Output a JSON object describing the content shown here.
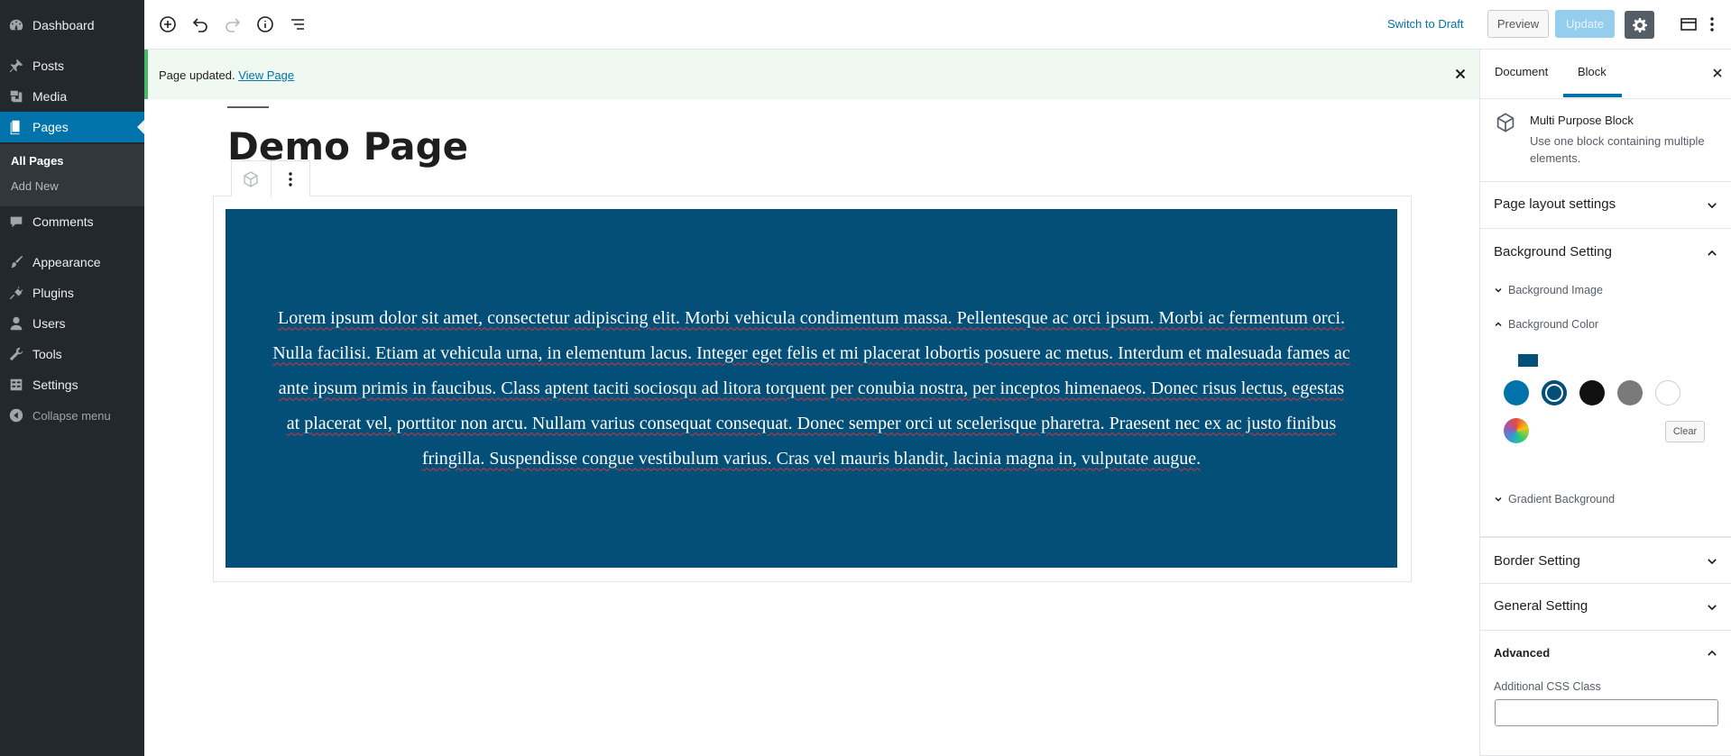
{
  "admin_menu": {
    "items": [
      {
        "label": "Dashboard",
        "icon": "dashboard-icon"
      },
      {
        "label": "Posts",
        "icon": "pin-icon"
      },
      {
        "label": "Media",
        "icon": "media-icon"
      },
      {
        "label": "Pages",
        "icon": "pages-icon",
        "current": true
      },
      {
        "label": "Comments",
        "icon": "comment-icon"
      },
      {
        "label": "Appearance",
        "icon": "brush-icon"
      },
      {
        "label": "Plugins",
        "icon": "plug-icon"
      },
      {
        "label": "Users",
        "icon": "user-icon"
      },
      {
        "label": "Tools",
        "icon": "wrench-icon"
      },
      {
        "label": "Settings",
        "icon": "settings-icon"
      },
      {
        "label": "Collapse menu",
        "icon": "collapse-icon"
      }
    ],
    "submenu": [
      "All Pages",
      "Add New"
    ]
  },
  "toolbar": {
    "switch_to_draft": "Switch to Draft",
    "preview": "Preview",
    "update": "Update"
  },
  "notice": {
    "text": "Page updated.",
    "link": "View Page"
  },
  "editor": {
    "page_title": "Demo Page",
    "block_text": "Lorem ipsum dolor sit amet, consectetur adipiscing elit. Morbi vehicula condimentum massa. Pellentesque ac orci ipsum. Morbi ac fermentum orci. Nulla facilisi. Etiam at vehicula urna, in elementum lacus. Integer eget felis et mi placerat lobortis posuere ac metus. Interdum et malesuada fames ac ante ipsum primis in faucibus. Class aptent taciti sociosqu ad litora torquent per conubia nostra, per inceptos himenaeos. Donec risus lectus, egestas at placerat vel, porttitor non arcu. Nullam varius consequat consequat. Donec semper orci ut scelerisque pharetra. Praesent nec ex ac justo finibus fringilla. Suspendisse congue vestibulum varius. Cras vel mauris blandit, lacinia magna in, vulputate augue.",
    "block_background": "#034f78"
  },
  "sidebar": {
    "tabs": [
      "Document",
      "Block"
    ],
    "active_tab": "Block",
    "block": {
      "title": "Multi Purpose Block",
      "description": "Use one block containing multiple elements."
    },
    "panels": {
      "page_layout": "Page layout settings",
      "background": "Background Setting",
      "background_image": "Background Image",
      "background_color": "Background Color",
      "gradient": "Gradient Background",
      "border": "Border Setting",
      "general": "General Setting",
      "advanced": "Advanced",
      "css_class_label": "Additional CSS Class",
      "css_class_value": ""
    },
    "swatches": [
      "#0073aa",
      "#034f78",
      "#111111",
      "#7a7a7a",
      "#ffffff"
    ],
    "selected_color": "#034f78",
    "clear": "Clear"
  }
}
